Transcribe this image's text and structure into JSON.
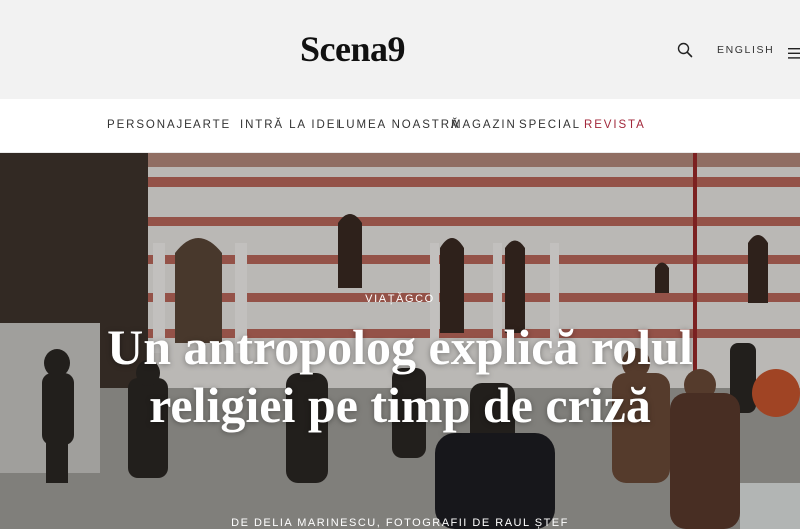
{
  "header": {
    "logo": "Scena9",
    "language": "ENGLISH",
    "search_icon": "search-icon",
    "menu_icon": "hamburger-menu-icon"
  },
  "nav": {
    "items": [
      {
        "label": "PERSONAJE"
      },
      {
        "label": "ARTE"
      },
      {
        "label": "INTRĂ LA IDEI"
      },
      {
        "label": "LUMEA NOASTRĂ"
      },
      {
        "label": "MAGAZIN"
      },
      {
        "label": "SPECIAL"
      },
      {
        "label": "REVISTA"
      }
    ],
    "accent_color": "#a2283b"
  },
  "article": {
    "category": "VIAȚĂGCO",
    "title": "Un antropolog explică rolul religiei pe timp de criză",
    "byline": "DE DELIA MARINESCU, FOTOGRAFII DE RAUL ȘTEF"
  }
}
